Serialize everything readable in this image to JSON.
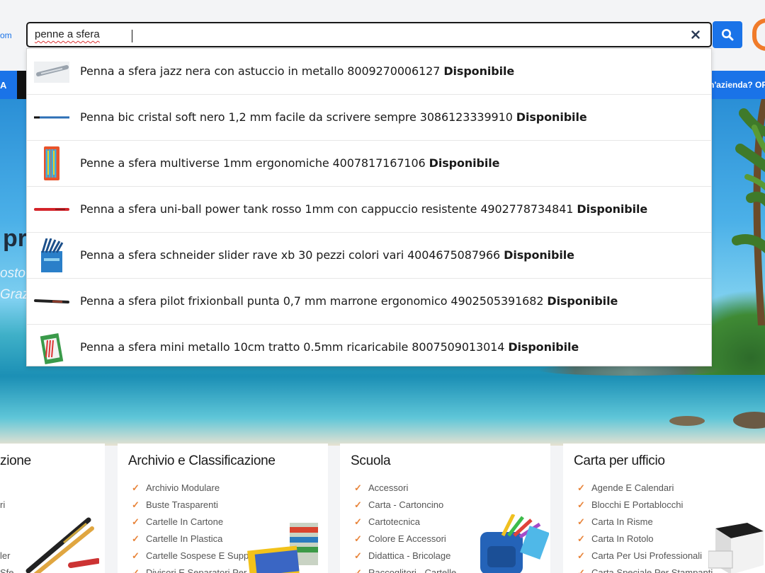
{
  "header": {
    "logo_fragment": "om",
    "search": {
      "value": "penne a sfera",
      "clear_icon": "close-icon",
      "button_icon": "search-icon"
    },
    "phone_icon": "phone-icon",
    "colors": {
      "accent": "#1a73e8",
      "orange": "#f07b2a"
    }
  },
  "nav": {
    "left_fragment": "A",
    "right_fragment": "n'azienda? OR"
  },
  "hero": {
    "line1": "pr",
    "line2": "osto",
    "line3": "Grazi"
  },
  "suggestions": [
    {
      "title": "Penna a sfera jazz nera con astuccio in metallo 8009270006127",
      "status": "Disponibile"
    },
    {
      "title": "Penna bic cristal soft nero 1,2 mm facile da scrivere sempre 3086123339910",
      "status": "Disponibile"
    },
    {
      "title": "Penne a sfera multiverse 1mm ergonomiche 4007817167106",
      "status": "Disponibile"
    },
    {
      "title": "Penna a sfera uni-ball power tank rosso 1mm con cappuccio resistente 4902778734841",
      "status": "Disponibile"
    },
    {
      "title": "Penna a sfera schneider slider rave xb 30 pezzi colori vari 4004675087966",
      "status": "Disponibile"
    },
    {
      "title": "Penna a sfera pilot frixionball punta 0,7 mm marrone ergonomico 4902505391682",
      "status": "Disponibile"
    },
    {
      "title": "Penna a sfera mini metallo 10cm tratto 0.5mm ricaricabile 8007509013014",
      "status": "Disponibile"
    }
  ],
  "categories": [
    {
      "title": "zione",
      "items": [
        "",
        "ri",
        "",
        "",
        "ler",
        "Sfe"
      ]
    },
    {
      "title": "Archivio e Classificazione",
      "items": [
        "Archivio Modulare",
        "Buste Trasparenti",
        "Cartelle In Cartone",
        "Cartelle In Plastica",
        "Cartelle Sospese E Supporti",
        "Divisori E Separatori Per Archivio"
      ]
    },
    {
      "title": "Scuola",
      "items": [
        "Accessori",
        "Carta - Cartoncino",
        "Cartotecnica",
        "Colore E Accessori",
        "Didattica - Bricolage",
        "Raccoglitori - Cartelle"
      ]
    },
    {
      "title": "Carta per ufficio",
      "items": [
        "Agende E Calendari",
        "Blocchi E Portablocchi",
        "Carta In Risme",
        "Carta In Rotolo",
        "Carta Per Usi Professionali",
        "Carta Speciale Per Stampanti"
      ]
    }
  ]
}
